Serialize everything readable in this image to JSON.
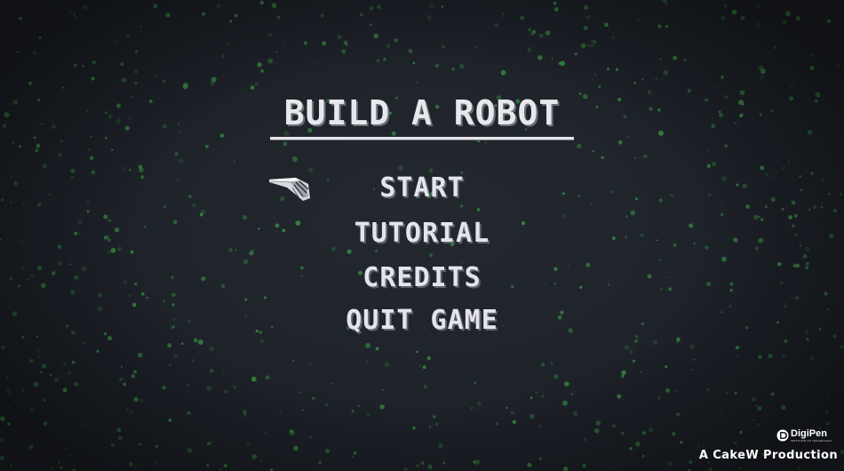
{
  "title": "BUILD A ROBOT",
  "menu": {
    "items": [
      {
        "label": "START",
        "selected": true
      },
      {
        "label": "TUTORIAL",
        "selected": false
      },
      {
        "label": "CREDITS",
        "selected": false
      },
      {
        "label": "QUIT GAME",
        "selected": false
      }
    ]
  },
  "footer": {
    "logo_brand": "DigiPen",
    "logo_subtitle": "INSTITUTE OF TECHNOLOGY",
    "production": "A CakeW Production"
  },
  "colors": {
    "background": "#1d2128",
    "text": "#e4e4ea",
    "particle": "#3fa84a"
  },
  "icons": {
    "selector": "robot-hand-pointer-icon",
    "logo": "digipen-logo-icon"
  }
}
